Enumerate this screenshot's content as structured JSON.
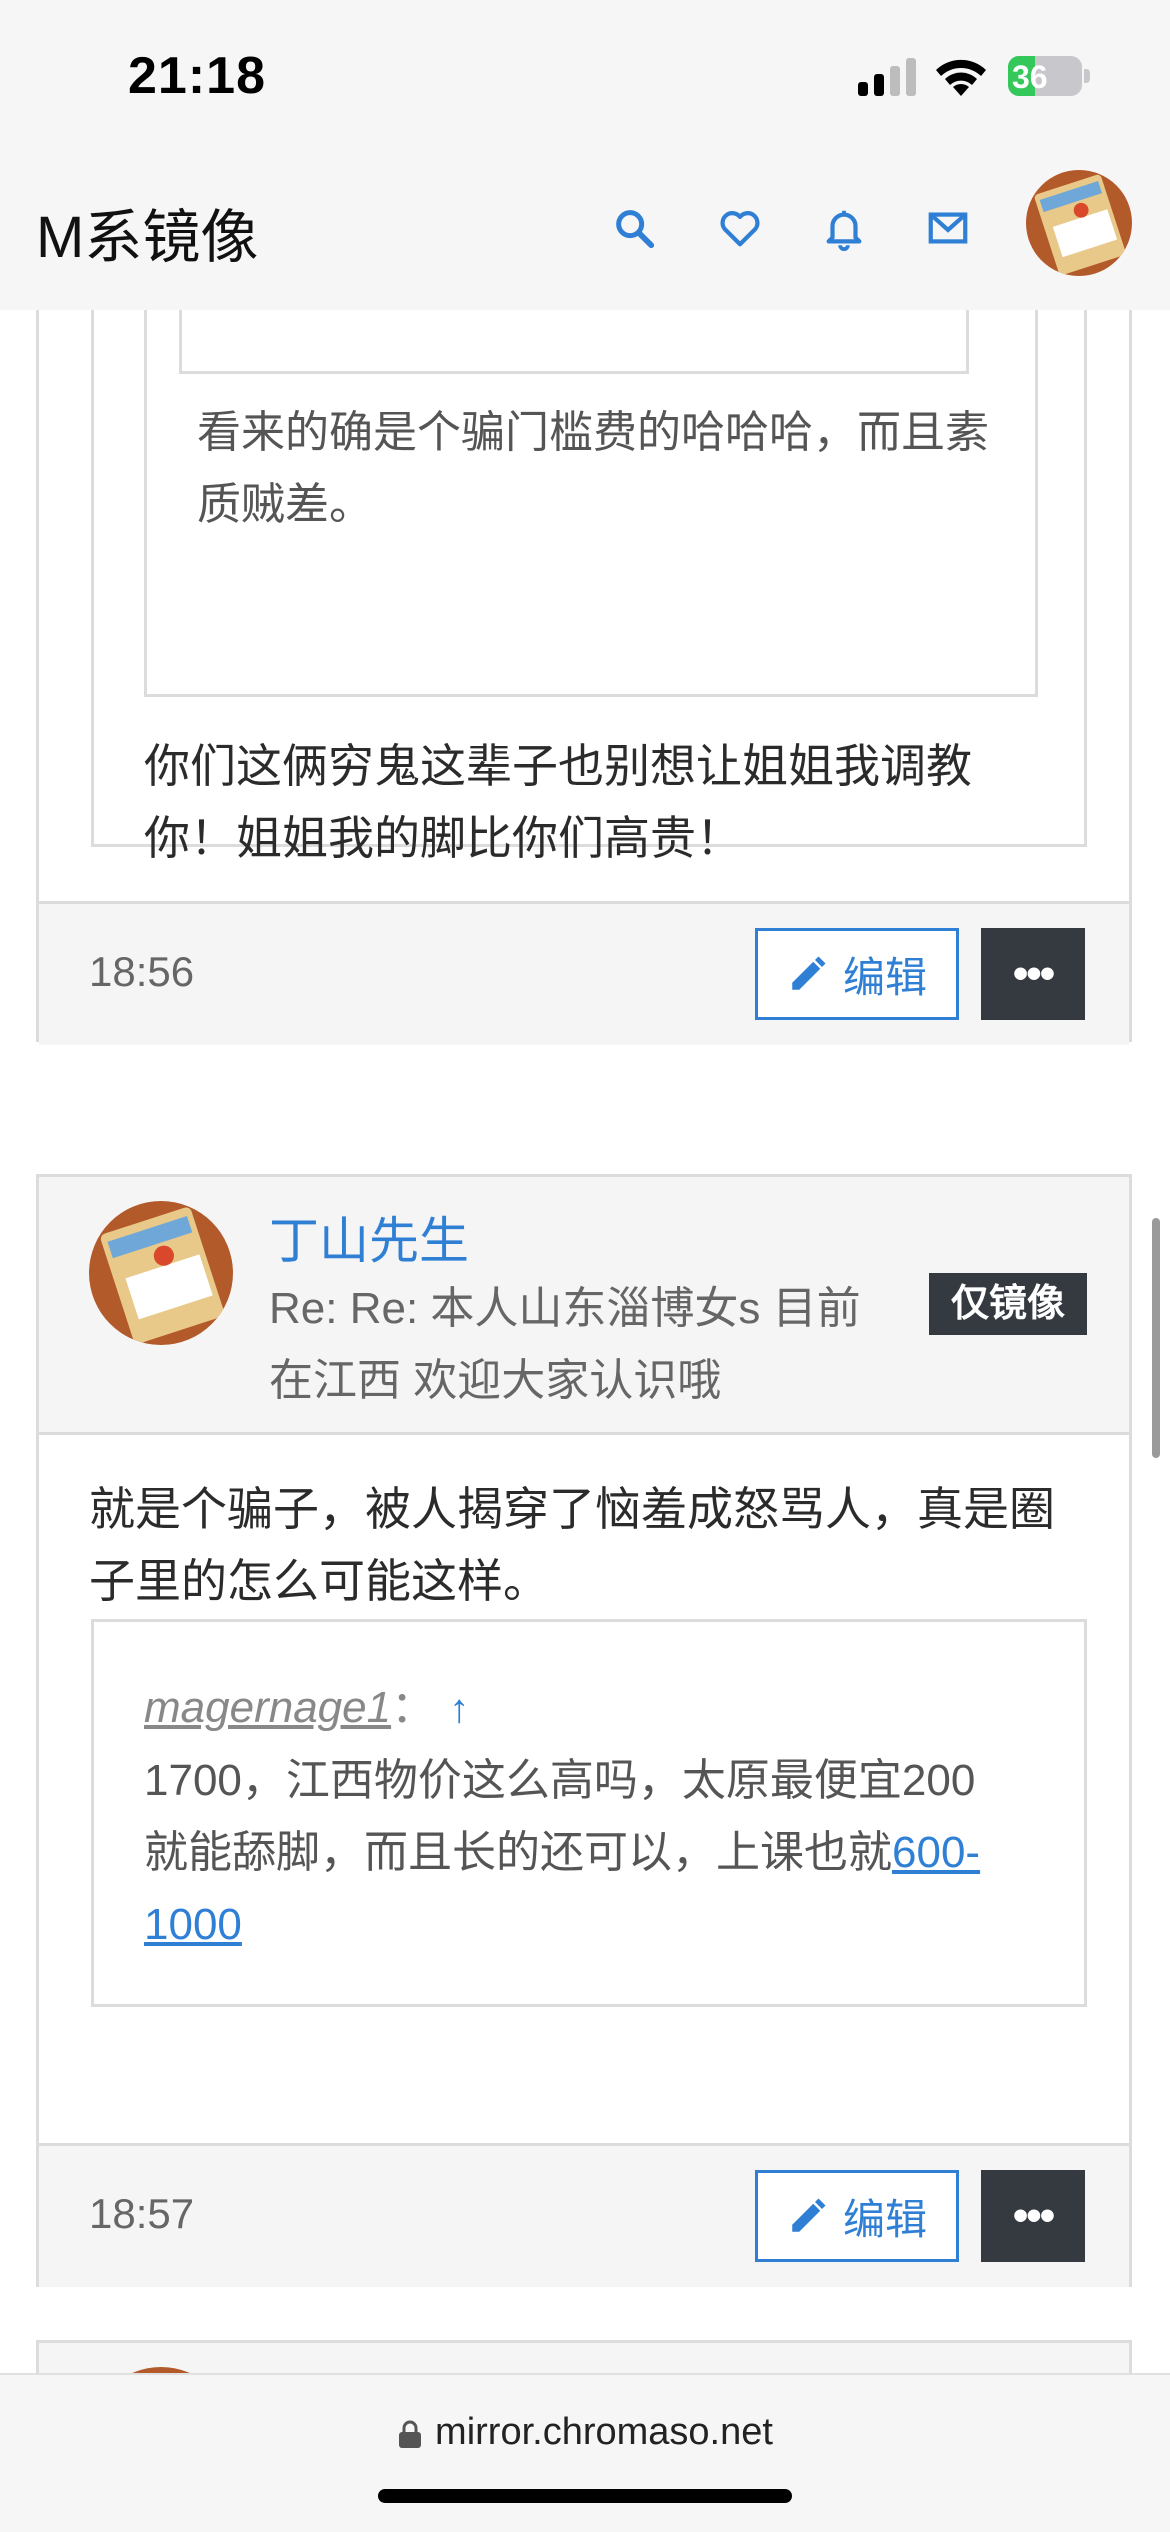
{
  "status": {
    "time": "21:18",
    "battery": "36",
    "battery_level": 0.36
  },
  "nav": {
    "brand": "M系镜像",
    "icons": [
      "search-icon",
      "heart-icon",
      "bell-icon",
      "mail-icon"
    ]
  },
  "post1": {
    "inner_quote_text": "看来的确是个骗门槛费的哈哈哈，而且素质贼差。",
    "reply_text": "你们这俩穷鬼这辈子也别想让姐姐我调教你！姐姐我的脚比你们高贵！",
    "time": "18:56",
    "edit_label": "编辑",
    "more_label": "•••"
  },
  "post2": {
    "author": "丁山先生",
    "subject": "Re: Re: 本人山东淄博女s 目前在江西 欢迎大家认识哦",
    "badge": "仅镜像",
    "body": "就是个骗子，被人揭穿了恼羞成怒骂人，真是圈子里的怎么可能这样。",
    "quote_author": "magernage1",
    "quote_colon": "：",
    "quote_up": "↑",
    "quote_text": "1700，江西物价这么高吗，太原最便宜200就能舔脚，而且长的还可以，上课也就",
    "quote_link": "600-1000",
    "time": "18:57",
    "edit_label": "编辑",
    "more_label": "•••"
  },
  "urlbar": {
    "url": "mirror.chromaso.net"
  },
  "colors": {
    "accent": "#2f7fd5",
    "dark": "#343a40",
    "border": "#dcdcdc"
  }
}
